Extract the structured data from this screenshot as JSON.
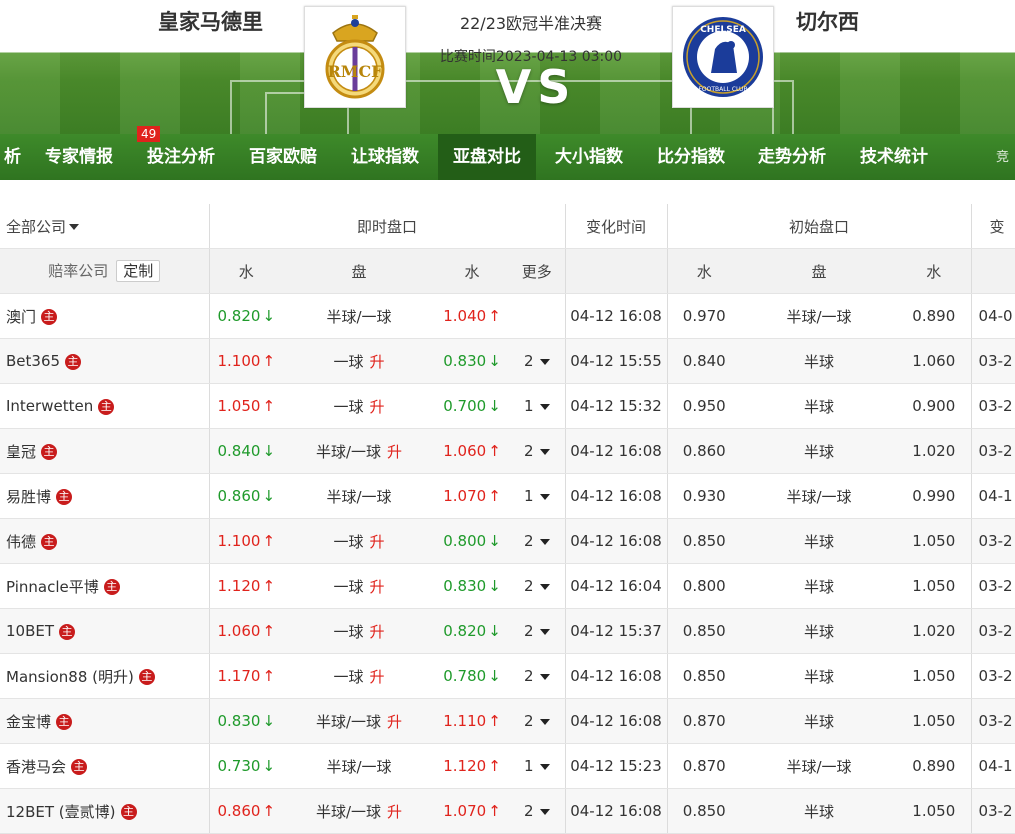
{
  "header": {
    "home_team": "皇家马德里",
    "away_team": "切尔西",
    "competition": "22/23欧冠半准决赛",
    "match_time": "比赛时间2023-04-13 03:00",
    "vs": "VS",
    "home_logo_text": "RMCF",
    "away_logo_text": "CHELSEA",
    "away_logo_sub": "FOOTBALL CLUB"
  },
  "nav": {
    "items": [
      "析",
      "专家情报",
      "投注分析",
      "百家欧赔",
      "让球指数",
      "亚盘对比",
      "大小指数",
      "比分指数",
      "走势分析",
      "技术统计",
      "竞"
    ],
    "badge": "49",
    "active": "亚盘对比"
  },
  "table": {
    "company_filter": "全部公司",
    "groups": {
      "live": "即时盘口",
      "change_time": "变化时间",
      "initial": "初始盘口",
      "change_partial": "变"
    },
    "sub": {
      "company": "赔率公司",
      "custom": "定制",
      "water": "水",
      "handicap": "盘",
      "more": "更多"
    },
    "zhu": "主",
    "rise": "升",
    "rows": [
      {
        "company": "澳门",
        "w1": "0.820",
        "w1_dir": "down",
        "hc": "半球/一球",
        "hc_up": false,
        "w2": "1.040",
        "w2_dir": "up",
        "more": "",
        "time": "04-12 16:08",
        "iw1": "0.970",
        "ihc": "半球/一球",
        "iw2": "0.890",
        "itime": "04-0"
      },
      {
        "company": "Bet365",
        "w1": "1.100",
        "w1_dir": "up",
        "hc": "一球",
        "hc_up": true,
        "w2": "0.830",
        "w2_dir": "down",
        "more": "2",
        "time": "04-12 15:55",
        "iw1": "0.840",
        "ihc": "半球",
        "iw2": "1.060",
        "itime": "03-2"
      },
      {
        "company": "Interwetten",
        "w1": "1.050",
        "w1_dir": "up",
        "hc": "一球",
        "hc_up": true,
        "w2": "0.700",
        "w2_dir": "down",
        "more": "1",
        "time": "04-12 15:32",
        "iw1": "0.950",
        "ihc": "半球",
        "iw2": "0.900",
        "itime": "03-2"
      },
      {
        "company": "皇冠",
        "w1": "0.840",
        "w1_dir": "down",
        "hc": "半球/一球",
        "hc_up": true,
        "w2": "1.060",
        "w2_dir": "up",
        "more": "2",
        "time": "04-12 16:08",
        "iw1": "0.860",
        "ihc": "半球",
        "iw2": "1.020",
        "itime": "03-2"
      },
      {
        "company": "易胜博",
        "w1": "0.860",
        "w1_dir": "down",
        "hc": "半球/一球",
        "hc_up": false,
        "w2": "1.070",
        "w2_dir": "up",
        "more": "1",
        "time": "04-12 16:08",
        "iw1": "0.930",
        "ihc": "半球/一球",
        "iw2": "0.990",
        "itime": "04-1"
      },
      {
        "company": "伟德",
        "w1": "1.100",
        "w1_dir": "up",
        "hc": "一球",
        "hc_up": true,
        "w2": "0.800",
        "w2_dir": "down",
        "more": "2",
        "time": "04-12 16:08",
        "iw1": "0.850",
        "ihc": "半球",
        "iw2": "1.050",
        "itime": "03-2"
      },
      {
        "company": "Pinnacle平博",
        "w1": "1.120",
        "w1_dir": "up",
        "hc": "一球",
        "hc_up": true,
        "w2": "0.830",
        "w2_dir": "down",
        "more": "2",
        "time": "04-12 16:04",
        "iw1": "0.800",
        "ihc": "半球",
        "iw2": "1.050",
        "itime": "03-2"
      },
      {
        "company": "10BET",
        "w1": "1.060",
        "w1_dir": "up",
        "hc": "一球",
        "hc_up": true,
        "w2": "0.820",
        "w2_dir": "down",
        "more": "2",
        "time": "04-12 15:37",
        "iw1": "0.850",
        "ihc": "半球",
        "iw2": "1.020",
        "itime": "03-2"
      },
      {
        "company": "Mansion88 (明升)",
        "w1": "1.170",
        "w1_dir": "up",
        "hc": "一球",
        "hc_up": true,
        "w2": "0.780",
        "w2_dir": "down",
        "more": "2",
        "time": "04-12 16:08",
        "iw1": "0.850",
        "ihc": "半球",
        "iw2": "1.050",
        "itime": "03-2"
      },
      {
        "company": "金宝博",
        "w1": "0.830",
        "w1_dir": "down",
        "hc": "半球/一球",
        "hc_up": true,
        "w2": "1.110",
        "w2_dir": "up",
        "more": "2",
        "time": "04-12 16:08",
        "iw1": "0.870",
        "ihc": "半球",
        "iw2": "1.050",
        "itime": "03-2"
      },
      {
        "company": "香港马会",
        "w1": "0.730",
        "w1_dir": "down",
        "hc": "半球/一球",
        "hc_up": false,
        "w2": "1.120",
        "w2_dir": "up",
        "more": "1",
        "time": "04-12 15:23",
        "iw1": "0.870",
        "ihc": "半球/一球",
        "iw2": "0.890",
        "itime": "04-1"
      },
      {
        "company": "12BET (壹贰博)",
        "w1": "0.860",
        "w1_dir": "up",
        "hc": "半球/一球",
        "hc_up": true,
        "w2": "1.070",
        "w2_dir": "up",
        "more": "2",
        "time": "04-12 16:08",
        "iw1": "0.850",
        "ihc": "半球",
        "iw2": "1.050",
        "itime": "03-2"
      }
    ],
    "arrows": {
      "up": "↑",
      "down": "↓"
    }
  },
  "colors": {
    "up": "#e0231c",
    "down": "#1f9a2b",
    "nav": "#2f7420",
    "nav_active": "#235e17"
  }
}
